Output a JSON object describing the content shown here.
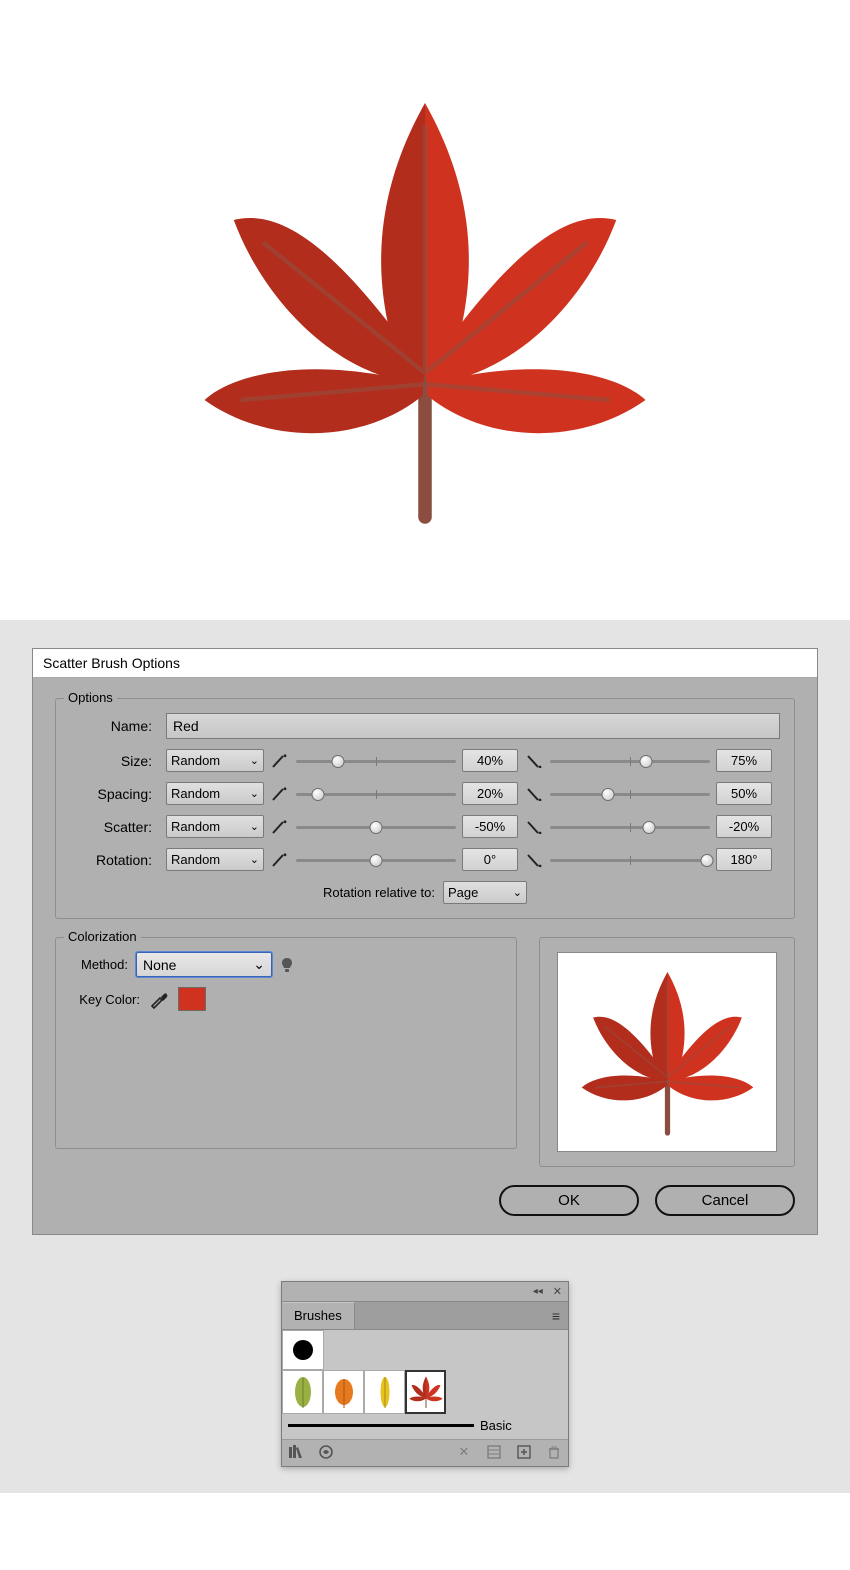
{
  "dialog": {
    "title": "Scatter Brush Options",
    "options_legend": "Options",
    "name_label": "Name:",
    "name_value": "Red",
    "size_label": "Size:",
    "spacing_label": "Spacing:",
    "scatter_label": "Scatter:",
    "rotation_label": "Rotation:",
    "random": "Random",
    "size_v1": "40%",
    "size_v2": "75%",
    "spacing_v1": "20%",
    "spacing_v2": "50%",
    "scatter_v1": "-50%",
    "scatter_v2": "-20%",
    "rotation_v1": "0°",
    "rotation_v2": "180°",
    "rot_rel_label": "Rotation relative to:",
    "rot_rel_value": "Page",
    "color_legend": "Colorization",
    "method_label": "Method:",
    "method_value": "None",
    "key_label": "Key Color:",
    "ok": "OK",
    "cancel": "Cancel"
  },
  "brushes": {
    "title": "Brushes",
    "basic": "Basic"
  },
  "slider_positions": {
    "size1": 26,
    "size2": 60,
    "spacing1": 14,
    "spacing2": 36,
    "scatter1": 50,
    "scatter2": 62,
    "rotation1": 50,
    "rotation2": 98
  }
}
